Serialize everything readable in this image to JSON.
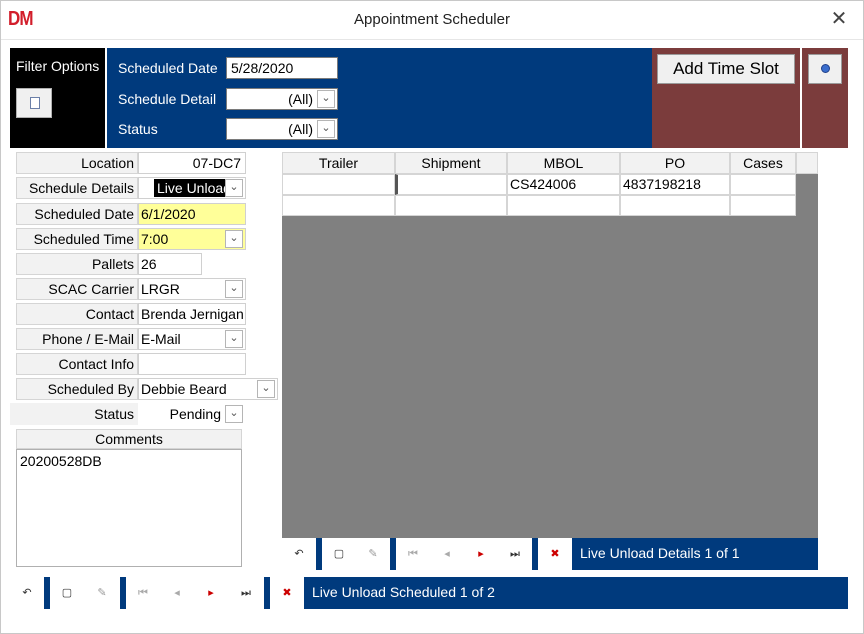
{
  "window": {
    "logo": "DM",
    "title": "Appointment Scheduler",
    "close_glyph": "✕"
  },
  "filter": {
    "label": "Filter Options",
    "icon": "filter-icon",
    "scheduled_date_label": "Scheduled Date",
    "scheduled_date_value": "5/28/2020",
    "schedule_detail_label": "Schedule Detail",
    "schedule_detail_value": "(All)",
    "status_label": "Status",
    "status_value": "(All)"
  },
  "toolbar": {
    "add_time_slot": "Add Time Slot",
    "help_icon": "info-icon"
  },
  "form": {
    "location_label": "Location",
    "location_value": "07-DC7",
    "schedule_details_label": "Schedule Details",
    "schedule_details_value": "Live Unload",
    "scheduled_date_label": "Scheduled Date",
    "scheduled_date_value": "6/1/2020",
    "scheduled_time_label": "Scheduled Time",
    "scheduled_time_value": "7:00",
    "pallets_label": "Pallets",
    "pallets_value": "26",
    "scac_label": "SCAC Carrier",
    "scac_value": "LRGR",
    "contact_label": "Contact",
    "contact_value": "Brenda Jernigan",
    "phone_label": "Phone / E-Mail",
    "phone_value": "E-Mail",
    "contact_info_label": "Contact Info",
    "contact_info_value": "",
    "scheduled_by_label": "Scheduled By",
    "scheduled_by_value": "Debbie Beard",
    "status_label": "Status",
    "status_value": "Pending",
    "comments_label": "Comments",
    "comments_value": "20200528DB"
  },
  "grid": {
    "columns": [
      "Trailer",
      "Shipment",
      "MBOL",
      "PO",
      "Cases"
    ],
    "rows": [
      [
        "",
        "",
        "CS424006",
        "4837198218",
        ""
      ],
      [
        "",
        "",
        "",
        "",
        ""
      ]
    ]
  },
  "nav": {
    "details_status": "Live Unload Details 1 of 1",
    "main_status": "Live Unload Scheduled 1 of 2"
  },
  "colors": {
    "header_blue": "#003a7d",
    "maroon": "#7b3c3c",
    "highlight_yellow": "#ffff99",
    "logo_red": "#d21e2b"
  }
}
